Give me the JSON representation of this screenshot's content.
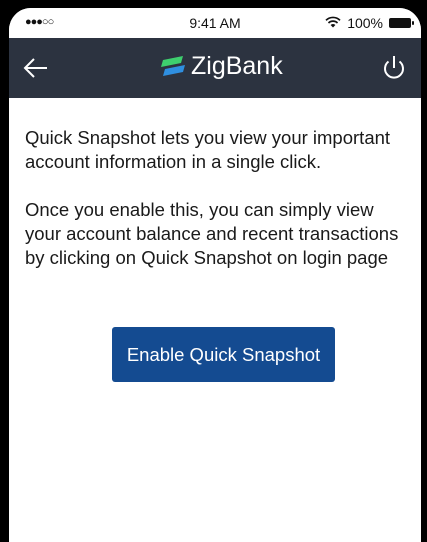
{
  "status_bar": {
    "signal": "●●●○○",
    "time": "9:41 AM",
    "battery_percent": "100%"
  },
  "header": {
    "back_icon": "back-arrow-icon",
    "logo_text": "ZigBank",
    "power_icon": "power-icon"
  },
  "main": {
    "paragraph1": "Quick Snapshot lets you view your important account information in a single click.",
    "paragraph2": "Once you enable this, you can simply view your account balance and recent transactions by clicking on Quick Snapshot on login page",
    "enable_button_label": "Enable Quick Snapshot"
  },
  "colors": {
    "header_bg": "#2c3340",
    "button_bg": "#144b91",
    "logo_green": "#3ecf6e",
    "logo_blue": "#2f8fe0"
  }
}
